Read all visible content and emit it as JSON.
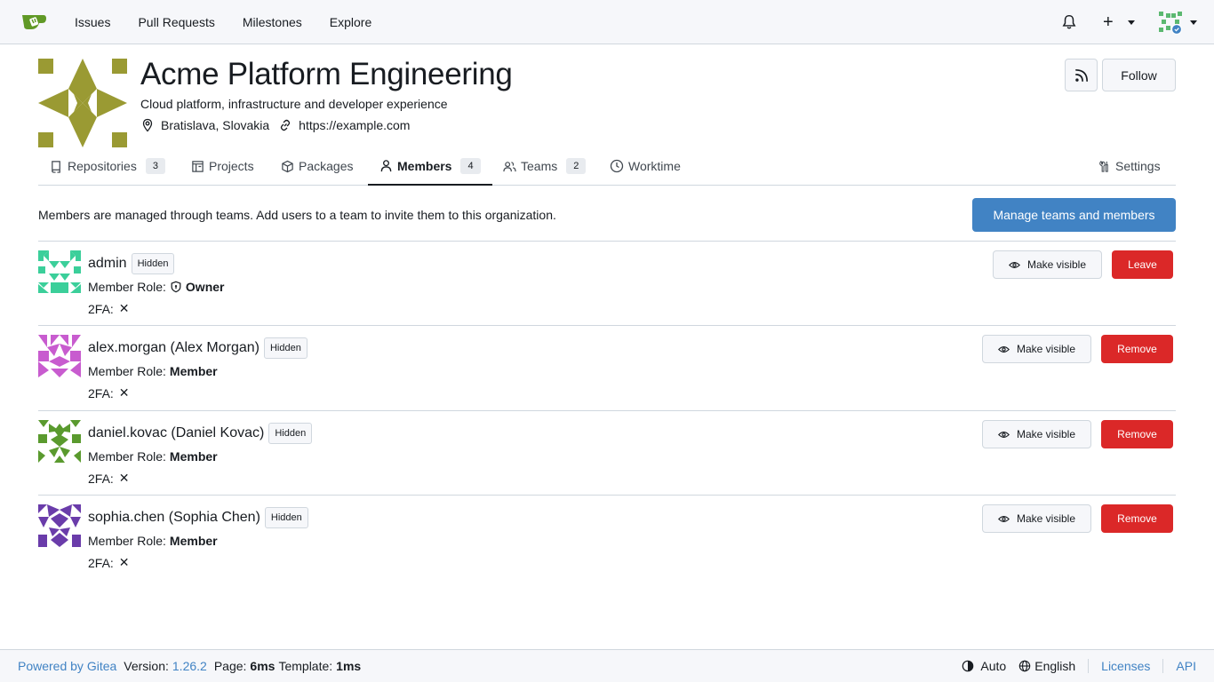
{
  "nav": {
    "links": [
      "Issues",
      "Pull Requests",
      "Milestones",
      "Explore"
    ],
    "plus_label": "+"
  },
  "org": {
    "name": "Acme Platform Engineering",
    "description": "Cloud platform, infrastructure and developer experience",
    "location": "Bratislava, Slovakia",
    "website": "https://example.com",
    "follow_label": "Follow",
    "avatar_color": "#9a9a33"
  },
  "tabs": [
    {
      "label": "Repositories",
      "count": "3"
    },
    {
      "label": "Projects"
    },
    {
      "label": "Packages"
    },
    {
      "label": "Members",
      "count": "4"
    },
    {
      "label": "Teams",
      "count": "2"
    },
    {
      "label": "Worktime"
    },
    {
      "label": "Settings"
    }
  ],
  "info": {
    "text": "Members are managed through teams. Add users to a team to invite them to this organization.",
    "manage_label": "Manage teams and members"
  },
  "members": [
    {
      "name": "admin",
      "badge": "Hidden",
      "role_label": "Member Role:",
      "role": "Owner",
      "twofa_label": "2FA:",
      "twofa": "✕",
      "visible_label": "Make visible",
      "action_label": "Leave",
      "avatar_color": "#3bcf9a"
    },
    {
      "name": "alex.morgan (Alex Morgan)",
      "badge": "Hidden",
      "role_label": "Member Role:",
      "role": "Member",
      "twofa_label": "2FA:",
      "twofa": "✕",
      "visible_label": "Make visible",
      "action_label": "Remove",
      "avatar_color": "#c85ccf"
    },
    {
      "name": "daniel.kovac (Daniel Kovac)",
      "badge": "Hidden",
      "role_label": "Member Role:",
      "role": "Member",
      "twofa_label": "2FA:",
      "twofa": "✕",
      "visible_label": "Make visible",
      "action_label": "Remove",
      "avatar_color": "#5a9a2e"
    },
    {
      "name": "sophia.chen (Sophia Chen)",
      "badge": "Hidden",
      "role_label": "Member Role:",
      "role": "Member",
      "twofa_label": "2FA:",
      "twofa": "✕",
      "visible_label": "Make visible",
      "action_label": "Remove",
      "avatar_color": "#6a3caa"
    }
  ],
  "footer": {
    "powered": "Powered by Gitea",
    "version_label": "Version:",
    "version": "1.26.2",
    "page_label": "Page:",
    "page_time": "6ms",
    "template_label": "Template:",
    "template_time": "1ms",
    "theme": "Auto",
    "language": "English",
    "licenses": "Licenses",
    "api": "API"
  },
  "colors": {
    "primary": "#4183c4",
    "danger": "#db2828",
    "nav_bg": "#f6f7fa",
    "border": "#d0d7de"
  }
}
